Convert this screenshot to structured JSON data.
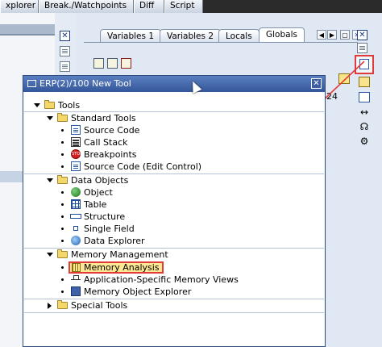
{
  "top_tabs": [
    "xplorer",
    "Break./Watchpoints",
    "Diff",
    "Script"
  ],
  "var_tabs": [
    "Variables 1",
    "Variables 2",
    "Locals",
    "Globals"
  ],
  "right_number": "24",
  "dialog": {
    "title": "ERP(2)/100 New Tool",
    "close_glyph": "✕"
  },
  "tree": {
    "root": "Tools",
    "standard_tools": {
      "label": "Standard Tools",
      "items": [
        "Source Code",
        "Call Stack",
        "Breakpoints",
        "Source Code (Edit Control)"
      ]
    },
    "data_objects": {
      "label": "Data Objects",
      "items": [
        "Object",
        "Table",
        "Structure",
        "Single Field",
        "Data Explorer"
      ]
    },
    "memory_management": {
      "label": "Memory Management",
      "items": [
        "Memory Analysis",
        "Application-Specific Memory Views",
        "Memory Object Explorer"
      ]
    },
    "special_tools": {
      "label": "Special Tools"
    }
  },
  "highlight_color": "#e03a3a",
  "selected_item": "Memory Analysis",
  "stop_icon_text": "STOP"
}
